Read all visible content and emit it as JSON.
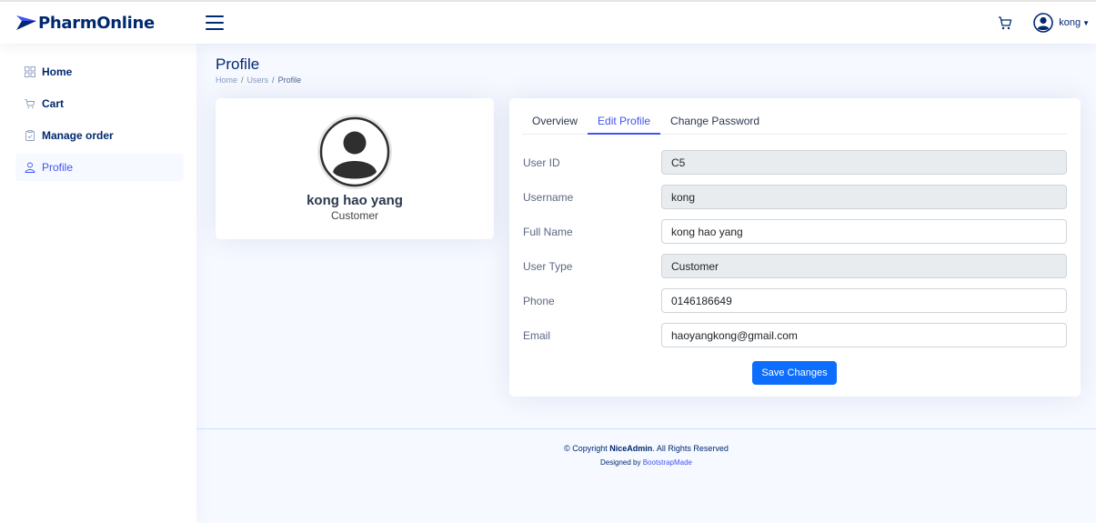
{
  "brand": {
    "name": "PharmOnline"
  },
  "header": {
    "user_name": "kong",
    "icons": [
      "menu-icon",
      "cart-icon",
      "user-avatar-icon",
      "caret-down-icon"
    ]
  },
  "sidebar": {
    "items": [
      {
        "label": "Home",
        "icon": "grid-icon",
        "active": false
      },
      {
        "label": "Cart",
        "icon": "cart-icon",
        "active": false
      },
      {
        "label": "Manage order",
        "icon": "clipboard-icon",
        "active": false
      },
      {
        "label": "Profile",
        "icon": "person-icon",
        "active": true
      }
    ]
  },
  "page": {
    "title": "Profile",
    "breadcrumb": [
      "Home",
      "Users",
      "Profile"
    ]
  },
  "profile_card": {
    "name": "kong hao yang",
    "role": "Customer"
  },
  "edit_card": {
    "tabs": [
      {
        "label": "Overview",
        "active": false
      },
      {
        "label": "Edit Profile",
        "active": true
      },
      {
        "label": "Change Password",
        "active": false
      }
    ],
    "fields": [
      {
        "label": "User ID",
        "value": "C5",
        "readonly": true
      },
      {
        "label": "Username",
        "value": "kong",
        "readonly": true
      },
      {
        "label": "Full Name",
        "value": "kong hao yang",
        "readonly": false
      },
      {
        "label": "User Type",
        "value": "Customer",
        "readonly": true
      },
      {
        "label": "Phone",
        "value": "0146186649",
        "readonly": false
      },
      {
        "label": "Email",
        "value": "haoyangkong@gmail.com",
        "readonly": false
      }
    ],
    "save_label": "Save Changes"
  },
  "footer": {
    "copyright_prefix": "© Copyright",
    "copyright_brand": "NiceAdmin",
    "copyright_suffix": ". All Rights Reserved",
    "designed_by": "Designed by",
    "designer": "BootstrapMade"
  },
  "colors": {
    "primary": "#4154f1",
    "navy": "#012970",
    "button": "#0d6efd",
    "background": "#f6f9ff"
  }
}
